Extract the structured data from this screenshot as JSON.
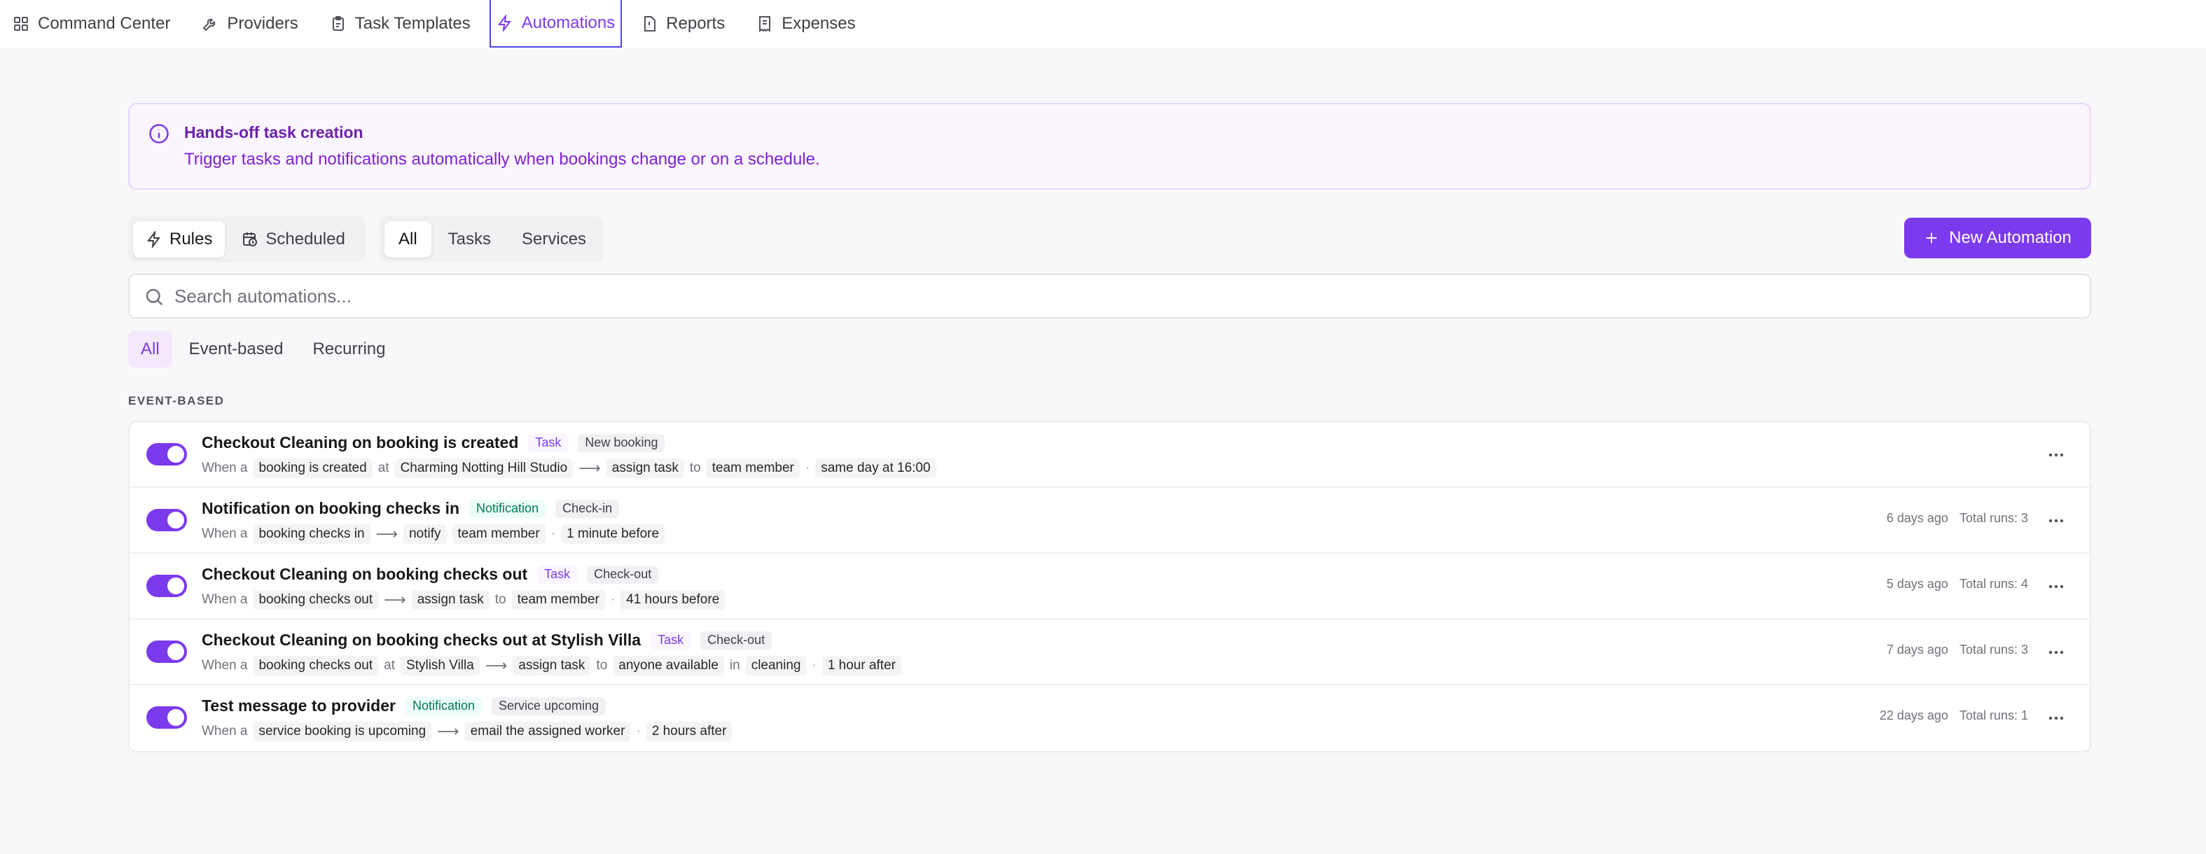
{
  "nav": {
    "items": [
      {
        "label": "Command Center",
        "icon": "grid-icon"
      },
      {
        "label": "Providers",
        "icon": "wrench-icon"
      },
      {
        "label": "Task Templates",
        "icon": "clipboard-icon"
      },
      {
        "label": "Automations",
        "icon": "bolt-icon",
        "active": true
      },
      {
        "label": "Reports",
        "icon": "report-icon"
      },
      {
        "label": "Expenses",
        "icon": "receipt-icon"
      }
    ]
  },
  "banner": {
    "title": "Hands-off task creation",
    "description": "Trigger tasks and notifications automatically when bookings change or on a schedule."
  },
  "toolbar": {
    "mode_tabs": [
      {
        "label": "Rules",
        "icon": "bolt-icon",
        "active": true
      },
      {
        "label": "Scheduled",
        "icon": "calendar-clock-icon",
        "active": false
      }
    ],
    "type_tabs": [
      {
        "label": "All",
        "active": true
      },
      {
        "label": "Tasks",
        "active": false
      },
      {
        "label": "Services",
        "active": false
      }
    ],
    "new_button_label": "New Automation"
  },
  "search": {
    "placeholder": "Search automations...",
    "value": ""
  },
  "filters": [
    {
      "label": "All",
      "active": true
    },
    {
      "label": "Event-based",
      "active": false
    },
    {
      "label": "Recurring",
      "active": false
    }
  ],
  "section_label": "EVENT-BASED",
  "rows": [
    {
      "name": "Checkout Cleaning on booking is created",
      "type_tag": "Task",
      "trigger_tag": "New booking",
      "when": "When a",
      "event": "booking is created",
      "at_label": "at",
      "property": "Charming Notting Hill Studio",
      "action": "assign task",
      "to_label": "to",
      "target": "team member",
      "timing": "same day at 16:00",
      "last_run": "",
      "total_runs": "",
      "enabled": true
    },
    {
      "name": "Notification on booking checks in",
      "type_tag": "Notification",
      "trigger_tag": "Check-in",
      "when": "When a",
      "event": "booking checks in",
      "action": "notify",
      "target": "team member",
      "timing": "1 minute before",
      "last_run": "6 days ago",
      "total_runs": "Total runs: 3",
      "enabled": true
    },
    {
      "name": "Checkout Cleaning on booking checks out",
      "type_tag": "Task",
      "trigger_tag": "Check-out",
      "when": "When a",
      "event": "booking checks out",
      "action": "assign task",
      "to_label": "to",
      "target": "team member",
      "timing": "41 hours before",
      "last_run": "5 days ago",
      "total_runs": "Total runs: 4",
      "enabled": true
    },
    {
      "name": "Checkout Cleaning on booking checks out at Stylish Villa",
      "type_tag": "Task",
      "trigger_tag": "Check-out",
      "when": "When a",
      "event": "booking checks out",
      "at_label": "at",
      "property": "Stylish Villa",
      "action": "assign task",
      "to_label": "to",
      "target": "anyone available",
      "in_label": "in",
      "department": "cleaning",
      "timing": "1 hour after",
      "last_run": "7 days ago",
      "total_runs": "Total runs: 3",
      "enabled": true
    },
    {
      "name": "Test message to provider",
      "type_tag": "Notification",
      "trigger_tag": "Service upcoming",
      "when": "When a",
      "event": "service booking is upcoming",
      "action": "email the assigned worker",
      "timing": "2 hours after",
      "last_run": "22 days ago",
      "total_runs": "Total runs: 1",
      "enabled": true
    }
  ],
  "colors": {
    "accent": "#7c3aed",
    "notification_tag": "#047857"
  }
}
